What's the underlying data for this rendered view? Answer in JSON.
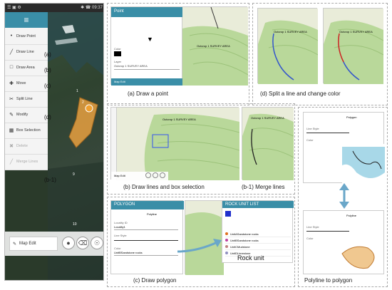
{
  "phone": {
    "status_left": "☰ ▣ ⚙",
    "status_right": "✱ ☎ 09:37",
    "menu_title": "≡",
    "menu": [
      {
        "icon": "•",
        "label": "Draw Point",
        "disabled": false,
        "tag": "(a)"
      },
      {
        "icon": "╱",
        "label": "Draw Line",
        "disabled": false,
        "tag": "(b)"
      },
      {
        "icon": "□",
        "label": "Draw Area",
        "disabled": false,
        "tag": "(c)"
      },
      {
        "icon": "✚",
        "label": "Move",
        "disabled": false,
        "tag": ""
      },
      {
        "icon": "✂",
        "label": "Split Line",
        "disabled": false,
        "tag": "(d)"
      },
      {
        "icon": "✎",
        "label": "Modify",
        "disabled": false,
        "tag": ""
      },
      {
        "icon": "▦",
        "label": "Box Selection",
        "disabled": false,
        "tag": ""
      },
      {
        "icon": "✖",
        "label": "Delete",
        "disabled": true,
        "tag": ""
      },
      {
        "icon": "╱",
        "label": "Merge Lines",
        "disabled": true,
        "tag": "(b-1)"
      }
    ],
    "map_edit": "Map Edit",
    "map_labels": [
      "1",
      "2",
      "9",
      "10"
    ]
  },
  "panel_a": {
    "title": "Point",
    "field1": "Color",
    "field2": "Layer",
    "layer_value": "Outcrop 1 SURVEY AREA",
    "map_label": "Outcrop 1 SURVEY AREA",
    "map_edit": "Map Edit",
    "caption": "(a) Draw a point"
  },
  "panel_d": {
    "left_label": "Outcrop 1 SURVEY AREA",
    "right_label": "Outcrop 1 SURVEY AREA",
    "caption": "(d) Split a line and change color"
  },
  "panel_b": {
    "label_left": "Outcrop 1 SURVEY AREA",
    "label_right": "Outcrop 1 SURVEY AREA",
    "map_edit": "Map Edit",
    "caption": "(b) Draw lines and  box selection",
    "caption2": "(b-1) Merge lines"
  },
  "panel_c": {
    "title": "POLYGON",
    "tab": "Polyline",
    "field_locality": "Locality ID",
    "locality_value": "Locality1",
    "field_line_style": "Line Style",
    "field_color": "Color",
    "color_value": "UnitBSandstone rocks",
    "rock_unit_header": "ROCK UNIT LIST",
    "rock_units": [
      "UnitASandstone rocks",
      "UnitBSandstone rocks",
      "UnitCMudstone",
      "UnitDLimestone"
    ],
    "rock_label": "Rock unit",
    "caption": "(c) Draw polygon"
  },
  "panel_e": {
    "top_title": "Polygon",
    "bottom_title": "Polyline",
    "field_line_style": "Line Style",
    "field_color": "Color",
    "caption": "Polyline to polygon"
  },
  "colors": {
    "accent": "#3a8ea7",
    "polygon": "#e8a040",
    "arrow": "#6aa7c9"
  }
}
